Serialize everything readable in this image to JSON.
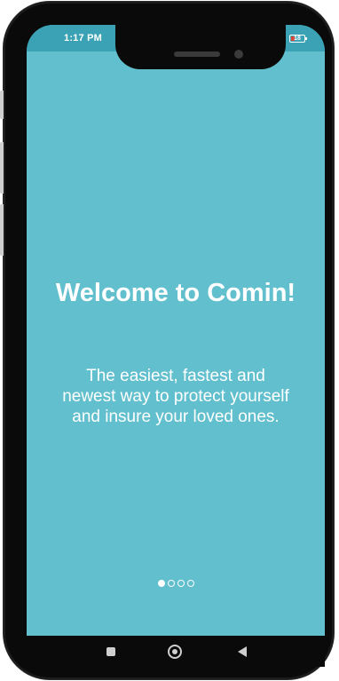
{
  "status_bar": {
    "time": "1:17 PM",
    "battery_level": "18",
    "battery_color": "#e0463c",
    "icons": [
      "signal-icon",
      "wifi-icon",
      "battery-icon"
    ]
  },
  "onboarding": {
    "title": "Welcome to Comin!",
    "subtitle": "The easiest, fastest and newest way to protect yourself and insure your loved ones.",
    "page_indicator": {
      "total": 4,
      "current": 1
    }
  },
  "nav_bar": {
    "buttons": [
      "recents-icon",
      "home-icon",
      "back-icon"
    ]
  },
  "colors": {
    "background": "#62bfcd",
    "status_bar": "#3aa2b4",
    "text": "#ffffff"
  }
}
